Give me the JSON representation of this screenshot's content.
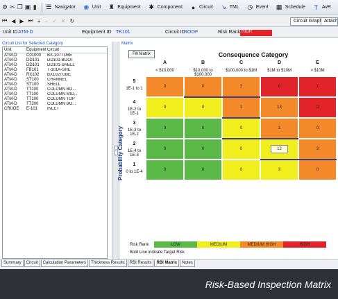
{
  "toolbar": {
    "buttons": [
      {
        "label": "Navigator",
        "icon": "navigator-icon"
      },
      {
        "label": "Unit",
        "icon": "unit-icon"
      },
      {
        "label": "Equipment",
        "icon": "equipment-icon"
      },
      {
        "label": "Component",
        "icon": "component-icon"
      },
      {
        "label": "Circuit",
        "icon": "circuit-icon"
      },
      {
        "label": "TML",
        "icon": "tml-icon"
      },
      {
        "label": "Event",
        "icon": "event-icon"
      },
      {
        "label": "Schedule",
        "icon": "schedule-icon"
      },
      {
        "label": "AvR",
        "icon": "avr-icon"
      }
    ],
    "circuit_graphs": "Circuit Graphs",
    "attach": "Attach"
  },
  "infobar": {
    "unit_label": "Unit ID",
    "unit_value": "ATM-D",
    "equipment_label": "Equipment ID",
    "equipment_value": "TK101",
    "circuit_label": "Circuit ID",
    "circuit_value": "ROOF",
    "risk_label": "Risk Rank",
    "risk_value": "HIGH",
    "risk_color": "#e3232a"
  },
  "circuit_list": {
    "title": "Circuit List for Selected Category",
    "headers": [
      "Unit",
      "Equipment",
      "Circuit"
    ],
    "rows": [
      [
        "ATM-D",
        "C01000",
        "BX-107TUBE"
      ],
      [
        "ATM-D",
        "DD101",
        "DD101-BOOT"
      ],
      [
        "ATM-D",
        "DD101",
        "DD101-SHELL"
      ],
      [
        "ATM-D",
        "FB101",
        "T-101A-SHE"
      ],
      [
        "ATM-D",
        "RX102",
        "BX102TUBE"
      ],
      [
        "ATM-D",
        "ST100",
        "CHANNEL"
      ],
      [
        "ATM-D",
        "ST100",
        "SHELL"
      ],
      [
        "ATM-D",
        "TT100",
        "COLUMN BO..."
      ],
      [
        "ATM-D",
        "TT100",
        "COLUMN MID..."
      ],
      [
        "ATM-D",
        "TT100",
        "COLUMN TOP"
      ],
      [
        "ATM-D",
        "TT200",
        "COLUMN BO..."
      ],
      [
        "CRUDE",
        "E-101",
        "INLET"
      ]
    ]
  },
  "matrix": {
    "panel_title": "Matrix",
    "fill_button": "Fill Matrix",
    "consequence_title": "Consequence Category",
    "probability_title": "Probability Category",
    "columns": [
      {
        "letter": "A",
        "range": "< $10,000"
      },
      {
        "letter": "B",
        "range": "$10,000 to $100,000"
      },
      {
        "letter": "C",
        "range": "$100,000 to $1M"
      },
      {
        "letter": "D",
        "range": "$1M to $10M"
      },
      {
        "letter": "E",
        "range": "> $10M"
      }
    ],
    "rows": [
      {
        "num": "5",
        "range": "1E-1 to 1"
      },
      {
        "num": "4",
        "range": "1E-2 to 1E-1"
      },
      {
        "num": "3",
        "range": "1E-3 to 1E-2"
      },
      {
        "num": "2",
        "range": "1E-4 to 1E-3"
      },
      {
        "num": "1",
        "range": "0 to 1E-4"
      }
    ],
    "cells": [
      [
        {
          "v": "0",
          "c": "orange"
        },
        {
          "v": "0",
          "c": "orange"
        },
        {
          "v": "1",
          "c": "orange"
        },
        {
          "v": "6",
          "c": "red"
        },
        {
          "v": "1",
          "c": "red"
        }
      ],
      [
        {
          "v": "0",
          "c": "yellow"
        },
        {
          "v": "0",
          "c": "yellow"
        },
        {
          "v": "1",
          "c": "orange"
        },
        {
          "v": "13",
          "c": "orange"
        },
        {
          "v": "3",
          "c": "red"
        }
      ],
      [
        {
          "v": "0",
          "c": "green"
        },
        {
          "v": "0",
          "c": "green"
        },
        {
          "v": "0",
          "c": "yellow"
        },
        {
          "v": "1",
          "c": "orange"
        },
        {
          "v": "0",
          "c": "orange"
        }
      ],
      [
        {
          "v": "0",
          "c": "green"
        },
        {
          "v": "0",
          "c": "green"
        },
        {
          "v": "0",
          "c": "yellow"
        },
        {
          "v": "12",
          "c": "yellow",
          "box": true
        },
        {
          "v": "3",
          "c": "orange"
        }
      ],
      [
        {
          "v": "0",
          "c": "green"
        },
        {
          "v": "0",
          "c": "green"
        },
        {
          "v": "0",
          "c": "yellow"
        },
        {
          "v": "3",
          "c": "yellow"
        },
        {
          "v": "0",
          "c": "orange"
        }
      ]
    ],
    "colors": {
      "green": "#5bb947",
      "yellow": "#f0ee1c",
      "orange": "#f4892a",
      "red": "#e3232a"
    },
    "legend_label": "Risk Rank",
    "legend": [
      {
        "label": "LOW",
        "c": "green"
      },
      {
        "label": "MEDIUM",
        "c": "yellow"
      },
      {
        "label": "MEDIUM HIGH",
        "c": "orange"
      },
      {
        "label": "HIGH",
        "c": "red"
      }
    ],
    "note": "Bold Line indicate Target Risk"
  },
  "bottom_tabs": [
    "Summary",
    "Circuit",
    "Calculation Parameters",
    "Thickness Results",
    "RBI Results",
    "RBI Matrix",
    "Notes"
  ],
  "caption": "Risk-Based Inspection Matrix"
}
